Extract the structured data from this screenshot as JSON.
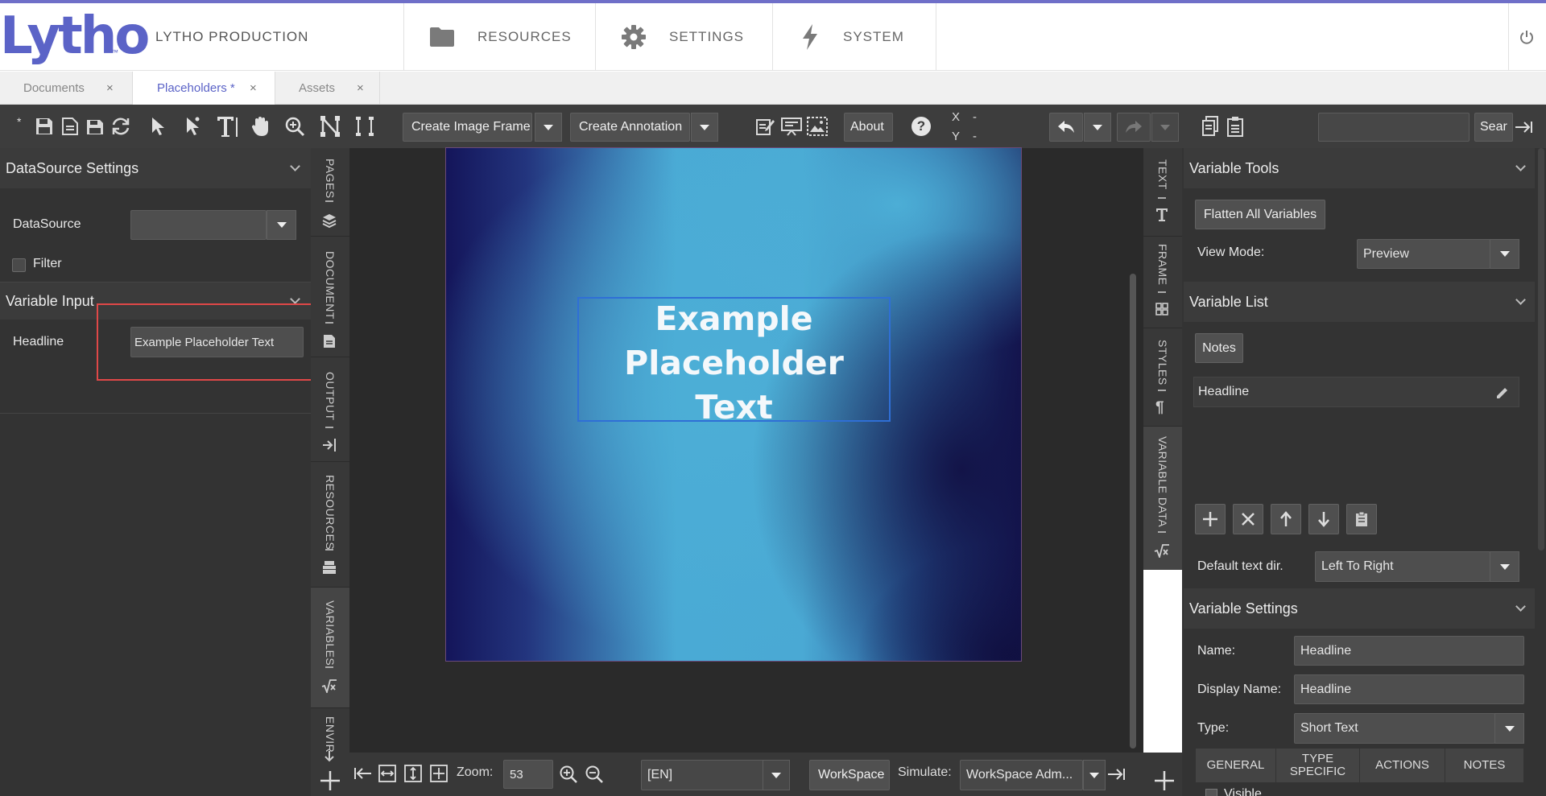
{
  "header": {
    "logo": "Lytho",
    "brand": "LYTHO PRODUCTION",
    "nav": [
      {
        "label": "RESOURCES",
        "icon": "folder-icon"
      },
      {
        "label": "SETTINGS",
        "icon": "gear-icon"
      },
      {
        "label": "SYSTEM",
        "icon": "lightning-icon"
      }
    ],
    "power_icon": "power-icon"
  },
  "doc_tabs": [
    {
      "label": "Documents",
      "active": false
    },
    {
      "label": "Placeholders *",
      "active": true
    },
    {
      "label": "Assets",
      "active": false
    }
  ],
  "tab_close": "×",
  "toolbar": {
    "asterisk": "*",
    "create_image_frame": "Create Image Frame",
    "create_annotation": "Create Annotation",
    "about": "About",
    "help": "?",
    "x_label": "X",
    "x_value": "-",
    "y_label": "Y",
    "y_value": "-",
    "search_label": "Sear",
    "search_value": ""
  },
  "left_panel": {
    "datasource_settings": {
      "title": "DataSource Settings",
      "datasource_label": "DataSource",
      "datasource_value": "",
      "filter_label": "Filter",
      "filter_checked": false
    },
    "variable_input": {
      "title": "Variable Input",
      "headline_label": "Headline",
      "headline_value": "Example Placeholder Text"
    }
  },
  "left_vtabs": [
    {
      "label": "PAGES",
      "icon": "layers-icon"
    },
    {
      "label": "DOCUMENT",
      "icon": "document-icon"
    },
    {
      "label": "OUTPUT",
      "icon": "output-icon"
    },
    {
      "label": "RESOURCES",
      "icon": "resources-icon"
    },
    {
      "label": "VARIABLES",
      "icon": "variables-icon"
    },
    {
      "label": "ENVIR",
      "icon": "environment-icon"
    }
  ],
  "canvas": {
    "placeholder_lines": [
      "Example",
      "Placeholder",
      "Text"
    ]
  },
  "right_vtabs": [
    {
      "label": "TEXT",
      "icon": "text-icon"
    },
    {
      "label": "FRAME",
      "icon": "frame-icon"
    },
    {
      "label": "STYLES",
      "icon": "paragraph-icon"
    },
    {
      "label": "VARIABLE DATA",
      "icon": "variable-data-icon"
    }
  ],
  "right_panel": {
    "variable_tools": {
      "title": "Variable Tools",
      "flatten_button": "Flatten All Variables",
      "view_mode_label": "View Mode:",
      "view_mode_value": "Preview"
    },
    "variable_list": {
      "title": "Variable List",
      "notes_button": "Notes",
      "items": [
        "Headline"
      ],
      "default_text_dir_label": "Default text dir.",
      "default_text_dir_value": "Left To Right"
    },
    "variable_settings": {
      "title": "Variable Settings",
      "name_label": "Name:",
      "name_value": "Headline",
      "display_name_label": "Display Name:",
      "display_name_value": "Headline",
      "type_label": "Type:",
      "type_value": "Short Text",
      "subtabs": [
        "GENERAL",
        "TYPE SPECIFIC",
        "ACTIONS",
        "NOTES"
      ],
      "visible_label": "Visible"
    }
  },
  "bottom_bar": {
    "zoom_label": "Zoom:",
    "zoom_value": "53",
    "language_value": "[EN]",
    "workspace_button": "WorkSpace",
    "simulate_label": "Simulate:",
    "simulate_value": "WorkSpace Adm..."
  },
  "colors": {
    "accent": "#5b63c7",
    "highlight_red": "#e04848",
    "selection_blue": "#2f6fd6",
    "panel_bg": "#333333",
    "toolbar_bg": "#3d3d3d"
  }
}
